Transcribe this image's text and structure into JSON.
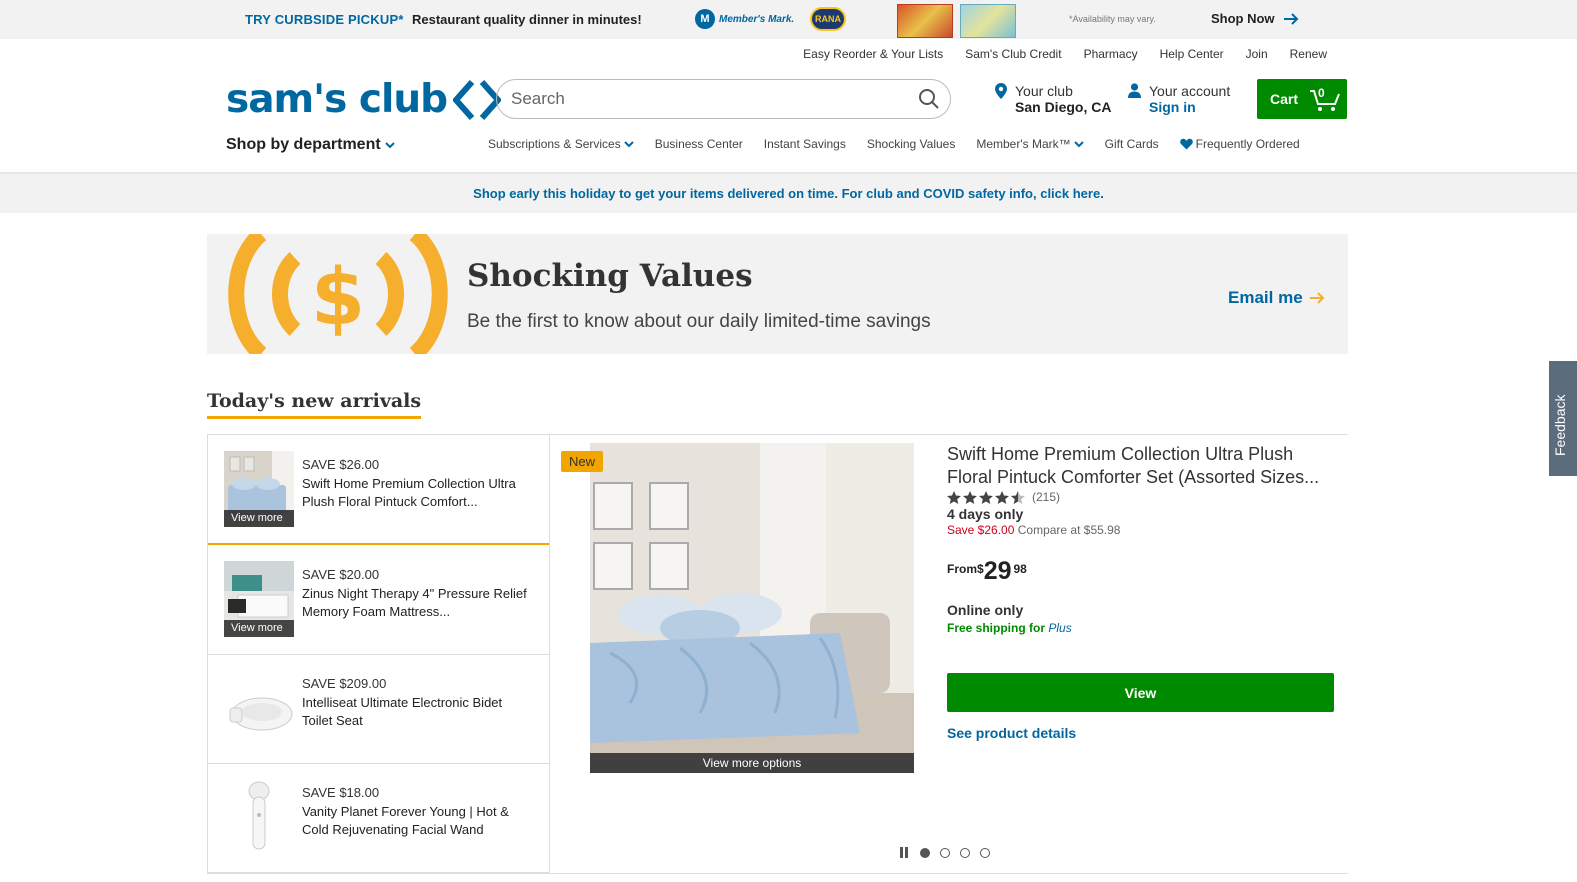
{
  "promo": {
    "curbside": "TRY CURBSIDE PICKUP*",
    "tagline": "Restaurant quality dinner in minutes!",
    "members_mark_logo": "Member's Mark.",
    "members_mark_badge": "M",
    "rana_logo": "RANA",
    "availability": "*Availability may vary.",
    "shop_now": "Shop Now"
  },
  "utility_links": [
    "Easy Reorder & Your Lists",
    "Sam's Club Credit",
    "Pharmacy",
    "Help Center",
    "Join",
    "Renew"
  ],
  "header": {
    "logo_text": "sam's club",
    "search_placeholder": "Search",
    "club_label": "Your club",
    "club_location": "San Diego, CA",
    "account_label": "Your account",
    "account_action": "Sign in",
    "cart_label": "Cart",
    "cart_count": "0"
  },
  "nav": {
    "shop_by_department": "Shop by department",
    "items": [
      {
        "label": "Subscriptions & Services",
        "dropdown": true
      },
      {
        "label": "Business Center",
        "dropdown": false
      },
      {
        "label": "Instant Savings",
        "dropdown": false
      },
      {
        "label": "Shocking Values",
        "dropdown": false
      },
      {
        "label": "Member's Mark™",
        "dropdown": true
      },
      {
        "label": "Gift Cards",
        "dropdown": false
      },
      {
        "label": "Frequently Ordered",
        "dropdown": false,
        "icon": "heart-icon"
      }
    ]
  },
  "holiday_banner": {
    "text": "Shop early this holiday to get your items delivered on time. For club and COVID safety info, ",
    "link": "click here."
  },
  "shocking_values": {
    "title": "Shocking Values",
    "subtitle": "Be the first to know about our daily limited-time savings",
    "email_cta": "Email me"
  },
  "arrivals": {
    "heading": "Today's new arrivals",
    "items": [
      {
        "save": "SAVE $26.00",
        "name": "Swift Home Premium Collection Ultra Plush Floral Pintuck Comfort...",
        "view_more": "View more",
        "active": true
      },
      {
        "save": "SAVE $20.00",
        "name": "Zinus Night Therapy 4\" Pressure Relief Memory Foam Mattress...",
        "view_more": "View more",
        "active": false
      },
      {
        "save": "SAVE $209.00",
        "name": "Intelliseat Ultimate Electronic Bidet Toilet Seat",
        "view_more": "",
        "active": false
      },
      {
        "save": "SAVE $18.00",
        "name": "Vanity Planet Forever Young | Hot & Cold Rejuvenating Facial Wand",
        "view_more": "",
        "active": false
      }
    ],
    "featured": {
      "badge": "New",
      "title": "Swift Home Premium Collection Ultra Plush Floral Pintuck Comforter Set (Assorted Sizes...",
      "rating": 4.5,
      "review_count": "(215)",
      "days_only": "4 days only",
      "save": "Save $26.00",
      "compare": "Compare at $55.98",
      "price_from": "From",
      "price_currency": "$",
      "price_whole": "29",
      "price_cents": "98",
      "availability": "Online only",
      "shipping": "Free shipping for ",
      "shipping_plus": "Plus",
      "view_button": "View",
      "details_link": "See product details",
      "view_more_options": "View more options",
      "carousel_total": 4,
      "carousel_active": 1
    }
  },
  "feedback": "Feedback",
  "colors": {
    "brand_blue": "#0067a0",
    "cta_green": "#008a00",
    "accent_orange": "#f0a500",
    "save_red": "#d0021b"
  }
}
